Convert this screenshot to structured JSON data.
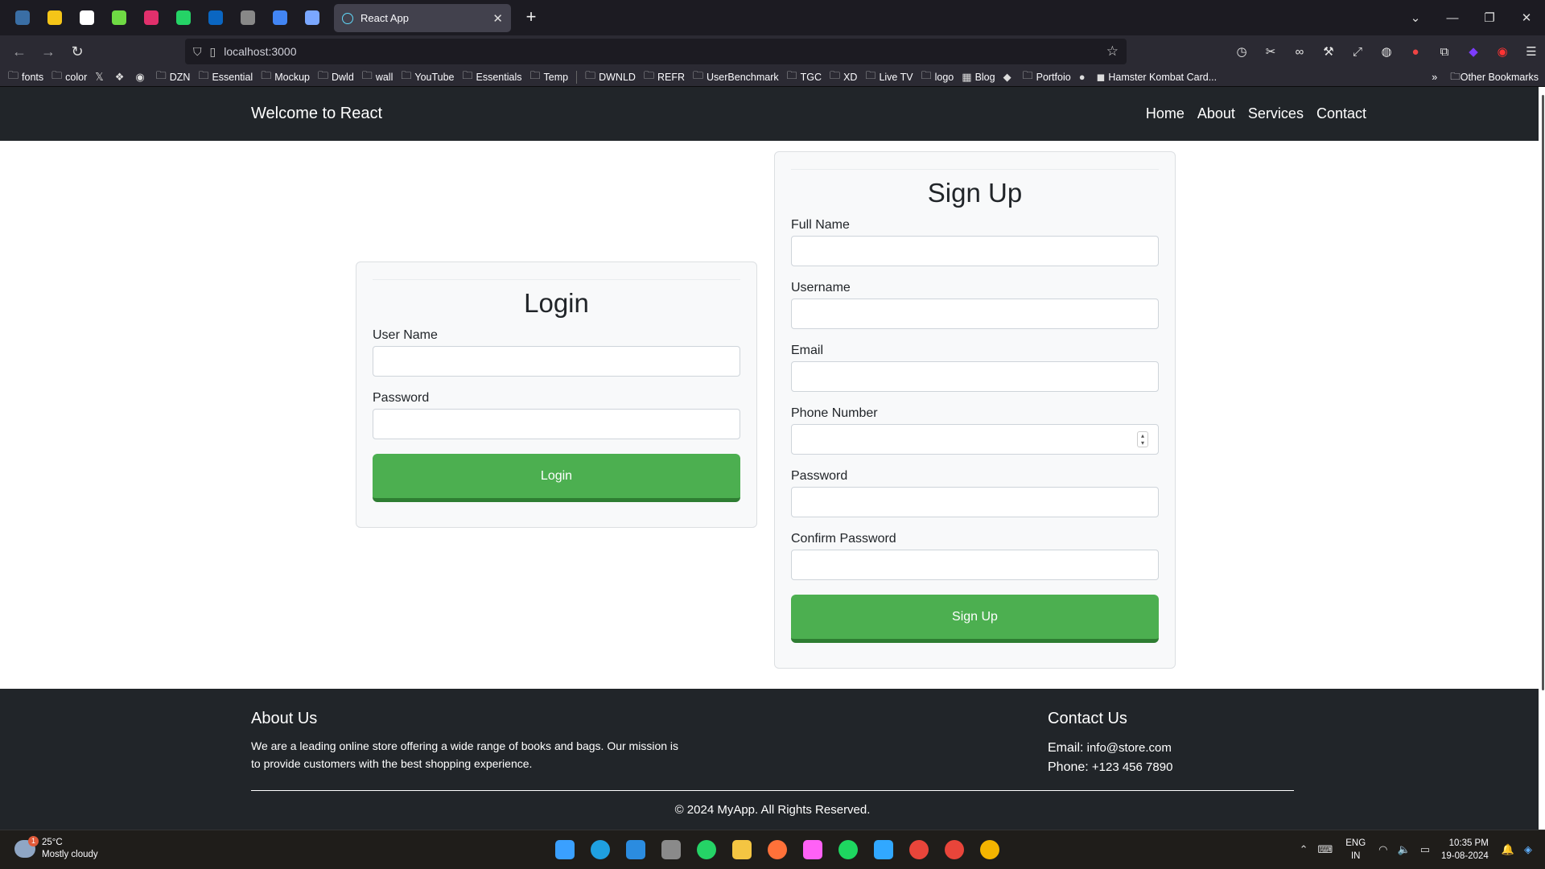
{
  "browser": {
    "tab_title": "React App",
    "tab_close": "✕",
    "new_tab": "+",
    "url": "localhost:3000",
    "pinned_icons": [
      "firefox-icon",
      "pencil-app-icon",
      "chatgpt-icon",
      "upwork-icon",
      "instagram-icon",
      "whatsapp-icon",
      "linkedin-icon",
      "wave-icon",
      "gemini-icon",
      "globe-icon"
    ],
    "pinned_colors": [
      "#3a6ea5",
      "#f5c518",
      "#ffffff",
      "#6fda44",
      "#e1306c",
      "#25d366",
      "#0a66c2",
      "#888888",
      "#4285f4",
      "#7aa7ff"
    ]
  },
  "bookmarks": [
    {
      "label": "fonts",
      "icon": "folder"
    },
    {
      "label": "color",
      "icon": "folder"
    },
    {
      "label": "",
      "icon": "x-logo"
    },
    {
      "label": "",
      "icon": "red-logo"
    },
    {
      "label": "",
      "icon": "blue-circle"
    },
    {
      "label": "DZN",
      "icon": "folder"
    },
    {
      "label": "Essential",
      "icon": "folder"
    },
    {
      "label": "Mockup",
      "icon": "folder"
    },
    {
      "label": "Dwld",
      "icon": "folder"
    },
    {
      "label": "wall",
      "icon": "folder"
    },
    {
      "label": "YouTube",
      "icon": "folder"
    },
    {
      "label": "Essentials",
      "icon": "folder"
    },
    {
      "label": "Temp",
      "icon": "folder"
    },
    {
      "label": "DWNLD",
      "icon": "folder"
    },
    {
      "label": "REFR",
      "icon": "folder"
    },
    {
      "label": "UserBenchmark",
      "icon": "folder"
    },
    {
      "label": "TGC",
      "icon": "folder"
    },
    {
      "label": "XD",
      "icon": "folder"
    },
    {
      "label": "Live TV",
      "icon": "folder"
    },
    {
      "label": "logo",
      "icon": "folder"
    },
    {
      "label": "Blog",
      "icon": "blog"
    },
    {
      "label": "",
      "icon": "purple-logo"
    },
    {
      "label": "Portfoio",
      "icon": "folder"
    },
    {
      "label": "",
      "icon": "spk-logo"
    },
    {
      "label": "Hamster Kombat Card...",
      "icon": "hamster"
    }
  ],
  "other_bookmarks": "Other Bookmarks",
  "app": {
    "brand": "Welcome to React",
    "nav": [
      "Home",
      "About",
      "Services",
      "Contact"
    ]
  },
  "login": {
    "title": "Login",
    "fields": [
      "User Name",
      "Password"
    ],
    "button": "Login"
  },
  "signup": {
    "title": "Sign Up",
    "fields": [
      "Full Name",
      "Username",
      "Email",
      "Phone Number",
      "Password",
      "Confirm Password"
    ],
    "button": "Sign Up"
  },
  "footer": {
    "about_title": "About Us",
    "about_text": "We are a leading online store offering a wide range of books and bags. Our mission is to provide customers with the best shopping experience.",
    "contact_title": "Contact Us",
    "email_label": "Email:",
    "email": "info@store.com",
    "phone_label": "Phone:",
    "phone": "+123 456 7890",
    "copyright": "© 2024 MyApp. All Rights Reserved."
  },
  "taskbar": {
    "temp": "25°C",
    "weather": "Mostly cloudy",
    "weather_badge": "1",
    "lang1": "ENG",
    "lang2": "IN",
    "time": "10:35 PM",
    "date": "19-08-2024",
    "app_icons": [
      "windows-start-icon",
      "edge-icon",
      "vscode-icon",
      "calculator-icon",
      "whatsapp-icon",
      "file-explorer-icon",
      "firefox-icon",
      "adobe-xd-icon",
      "spotify-icon",
      "photoshop-icon",
      "chrome-icon",
      "chrome-icon",
      "chrome-icon"
    ],
    "app_colors": [
      "#3aa0ff",
      "#1fa0e0",
      "#2b8ce0",
      "#8a8a8a",
      "#25d366",
      "#f4c542",
      "#ff7139",
      "#ff61f6",
      "#1ed760",
      "#31a8ff",
      "#e9453a",
      "#e9453a",
      "#f4b400"
    ]
  }
}
